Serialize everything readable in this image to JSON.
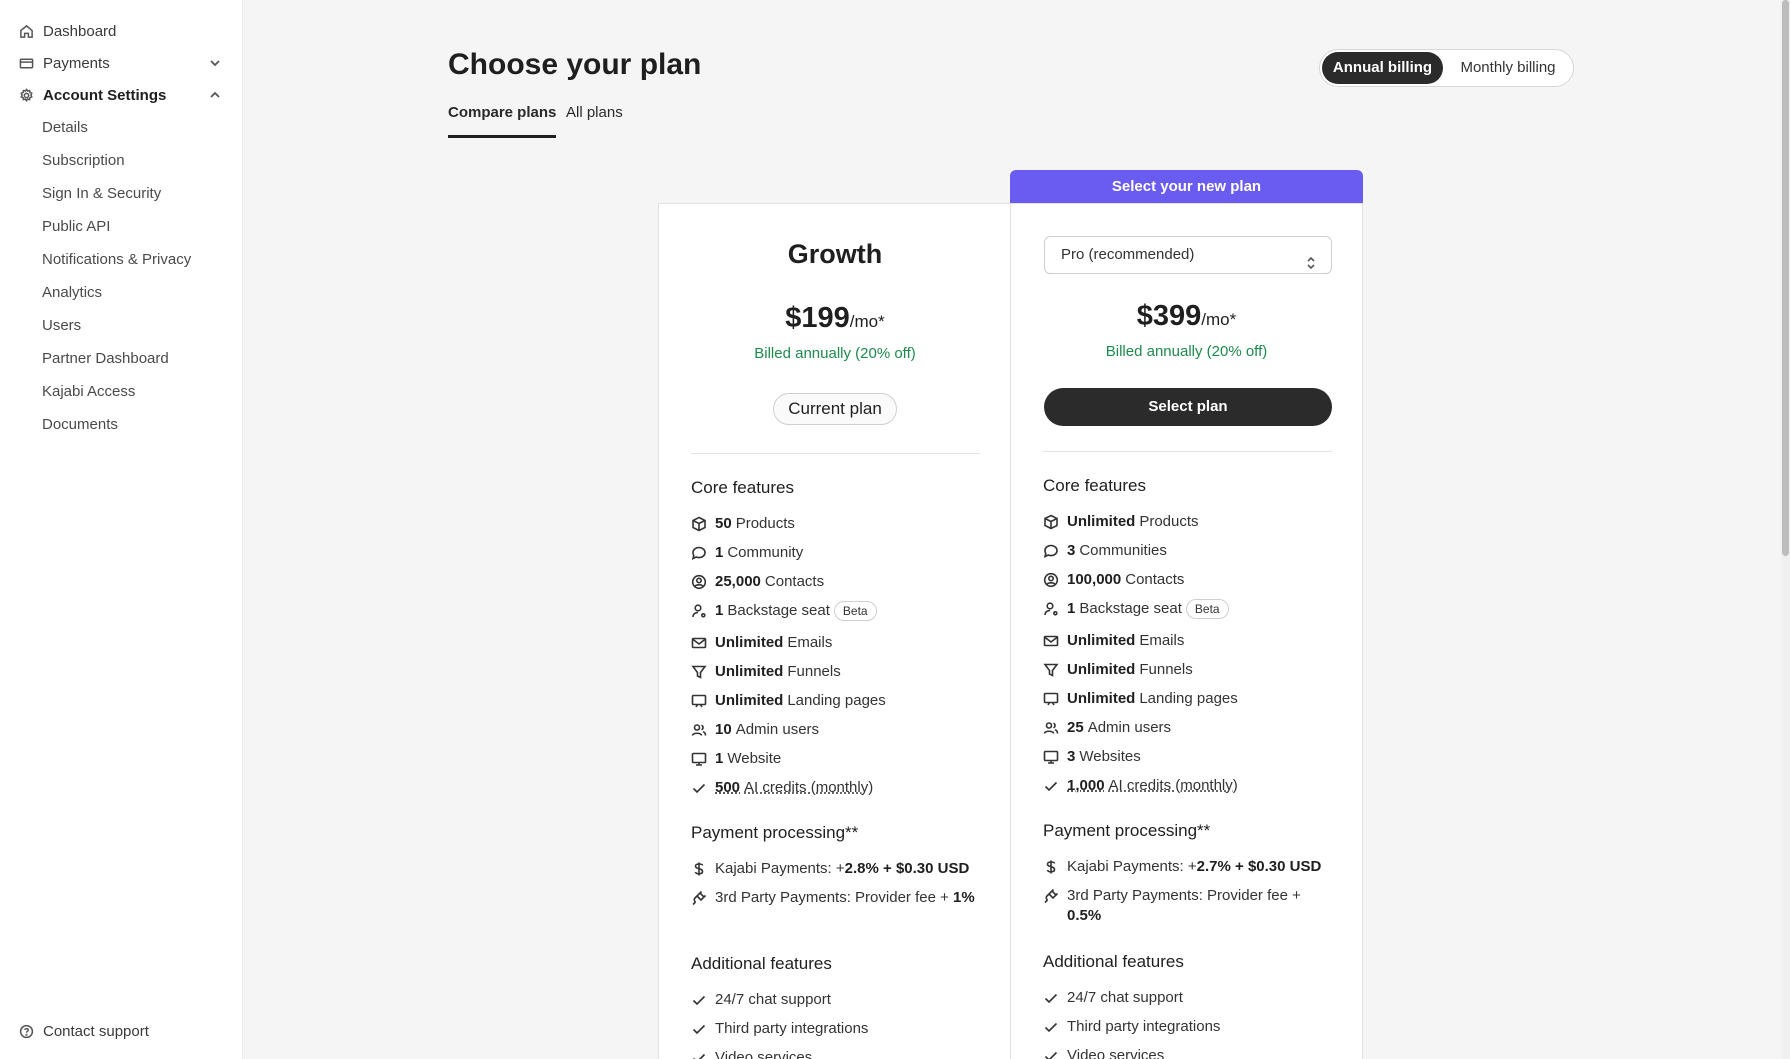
{
  "sidebar": {
    "items": [
      {
        "label": "Dashboard",
        "icon": "home-icon"
      },
      {
        "label": "Payments",
        "icon": "card-icon"
      },
      {
        "label": "Account Settings",
        "icon": "gear-icon"
      }
    ],
    "sub_items": [
      "Details",
      "Subscription",
      "Sign In & Security",
      "Public API",
      "Notifications & Privacy",
      "Analytics",
      "Users",
      "Partner Dashboard",
      "Kajabi Access",
      "Documents"
    ],
    "contact_support": "Contact support"
  },
  "header": {
    "title": "Choose your plan",
    "tabs": [
      "Compare plans",
      "All plans"
    ],
    "billing": {
      "annual": "Annual billing",
      "monthly": "Monthly billing"
    }
  },
  "banner": "Select your new plan",
  "plans": {
    "growth": {
      "name": "Growth",
      "price": "$199",
      "per": "/mo*",
      "billed": "Billed annually (20% off)",
      "current_label": "Current plan",
      "core_title": "Core features",
      "core": [
        {
          "bold": "50",
          "text": "Products"
        },
        {
          "bold": "1",
          "text": "Community"
        },
        {
          "bold": "25,000",
          "text": "Contacts"
        },
        {
          "bold": "1",
          "text": "Backstage seat",
          "badge": "Beta"
        },
        {
          "bold": "Unlimited",
          "text": "Emails"
        },
        {
          "bold": "Unlimited",
          "text": "Funnels"
        },
        {
          "bold": "Unlimited",
          "text": "Landing pages"
        },
        {
          "bold": "10",
          "text": "Admin users"
        },
        {
          "bold": "1",
          "text": "Website"
        },
        {
          "bold": "500",
          "text": "AI credits (monthly)"
        }
      ],
      "payment_title": "Payment processing**",
      "payments": [
        {
          "text": "Kajabi Payments: +",
          "bold": "2.8% + $0.30 USD"
        },
        {
          "text": "3rd Party Payments: Provider fee + ",
          "bold": "1%"
        }
      ],
      "additional_title": "Additional features",
      "additional": [
        "24/7 chat support",
        "Third party integrations",
        "Video services"
      ]
    },
    "pro": {
      "select_value": "Pro (recommended)",
      "price": "$399",
      "per": "/mo*",
      "billed": "Billed annually (20% off)",
      "select_label": "Select plan",
      "core_title": "Core features",
      "core": [
        {
          "bold": "Unlimited",
          "text": "Products"
        },
        {
          "bold": "3",
          "text": "Communities"
        },
        {
          "bold": "100,000",
          "text": "Contacts"
        },
        {
          "bold": "1",
          "text": "Backstage seat",
          "badge": "Beta"
        },
        {
          "bold": "Unlimited",
          "text": "Emails"
        },
        {
          "bold": "Unlimited",
          "text": "Funnels"
        },
        {
          "bold": "Unlimited",
          "text": "Landing pages"
        },
        {
          "bold": "25",
          "text": "Admin users"
        },
        {
          "bold": "3",
          "text": "Websites"
        },
        {
          "bold": "1,000",
          "text": "AI credits (monthly)"
        }
      ],
      "payment_title": "Payment processing**",
      "payments": [
        {
          "text": "Kajabi Payments: +",
          "bold": "2.7% + $0.30 USD"
        },
        {
          "text": "3rd Party Payments: Provider fee + ",
          "bold": "0.5%"
        }
      ],
      "additional_title": "Additional features",
      "additional": [
        "24/7 chat support",
        "Third party integrations",
        "Video services"
      ]
    }
  }
}
